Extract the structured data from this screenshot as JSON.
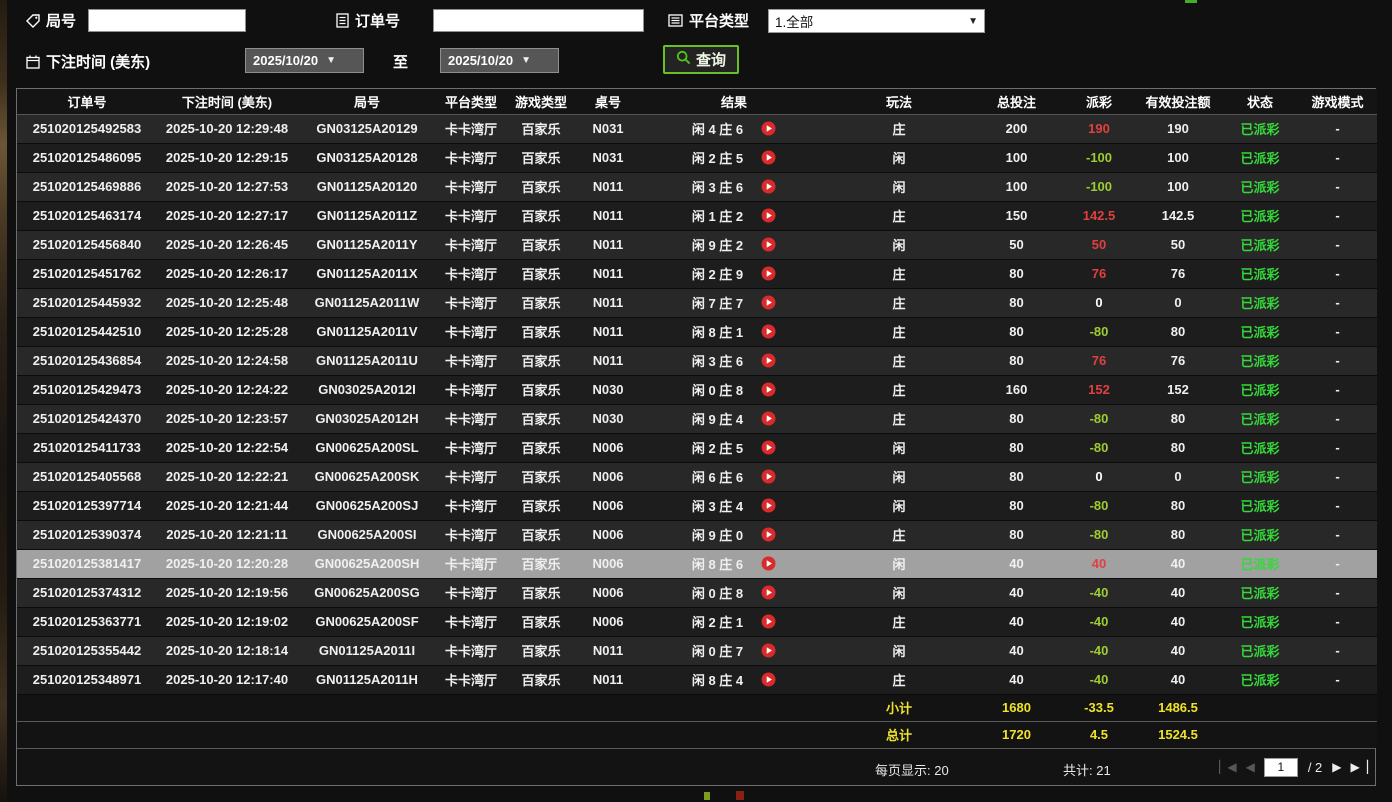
{
  "filters": {
    "round_label": "局号",
    "order_label": "订单号",
    "platform_label": "平台类型",
    "platform_value": "1.全部",
    "bet_time_label": "下注时间 (美东)",
    "to_label": "至",
    "date_from": "2025/10/20",
    "date_to": "2025/10/20",
    "query_label": "查询"
  },
  "table": {
    "columns": [
      "订单号",
      "下注时间 (美东)",
      "局号",
      "平台类型",
      "游戏类型",
      "桌号",
      "结果",
      "玩法",
      "总投注",
      "派彩",
      "有效投注额",
      "状态",
      "游戏模式"
    ],
    "rows": [
      {
        "order": "251020125492583",
        "time": "2025-10-20 12:29:48",
        "round": "GN03125A20129",
        "platform": "卡卡湾厅",
        "game": "百家乐",
        "table_no": "N031",
        "result": "闲 4 庄 6",
        "play": "庄",
        "total": "200",
        "payout": "190",
        "payout_type": "win",
        "valid": "190",
        "status": "已派彩",
        "mode": "-",
        "selected": false
      },
      {
        "order": "251020125486095",
        "time": "2025-10-20 12:29:15",
        "round": "GN03125A20128",
        "platform": "卡卡湾厅",
        "game": "百家乐",
        "table_no": "N031",
        "result": "闲 2 庄 5",
        "play": "闲",
        "total": "100",
        "payout": "-100",
        "payout_type": "loss",
        "valid": "100",
        "status": "已派彩",
        "mode": "-",
        "selected": false
      },
      {
        "order": "251020125469886",
        "time": "2025-10-20 12:27:53",
        "round": "GN01125A20120",
        "platform": "卡卡湾厅",
        "game": "百家乐",
        "table_no": "N011",
        "result": "闲 3 庄 6",
        "play": "闲",
        "total": "100",
        "payout": "-100",
        "payout_type": "loss",
        "valid": "100",
        "status": "已派彩",
        "mode": "-",
        "selected": false
      },
      {
        "order": "251020125463174",
        "time": "2025-10-20 12:27:17",
        "round": "GN01125A2011Z",
        "platform": "卡卡湾厅",
        "game": "百家乐",
        "table_no": "N011",
        "result": "闲 1 庄 2",
        "play": "庄",
        "total": "150",
        "payout": "142.5",
        "payout_type": "win",
        "valid": "142.5",
        "status": "已派彩",
        "mode": "-",
        "selected": false
      },
      {
        "order": "251020125456840",
        "time": "2025-10-20 12:26:45",
        "round": "GN01125A2011Y",
        "platform": "卡卡湾厅",
        "game": "百家乐",
        "table_no": "N011",
        "result": "闲 9 庄 2",
        "play": "闲",
        "total": "50",
        "payout": "50",
        "payout_type": "win",
        "valid": "50",
        "status": "已派彩",
        "mode": "-",
        "selected": false
      },
      {
        "order": "251020125451762",
        "time": "2025-10-20 12:26:17",
        "round": "GN01125A2011X",
        "platform": "卡卡湾厅",
        "game": "百家乐",
        "table_no": "N011",
        "result": "闲 2 庄 9",
        "play": "庄",
        "total": "80",
        "payout": "76",
        "payout_type": "win",
        "valid": "76",
        "status": "已派彩",
        "mode": "-",
        "selected": false
      },
      {
        "order": "251020125445932",
        "time": "2025-10-20 12:25:48",
        "round": "GN01125A2011W",
        "platform": "卡卡湾厅",
        "game": "百家乐",
        "table_no": "N011",
        "result": "闲 7 庄 7",
        "play": "庄",
        "total": "80",
        "payout": "0",
        "payout_type": "zero",
        "valid": "0",
        "status": "已派彩",
        "mode": "-",
        "selected": false
      },
      {
        "order": "251020125442510",
        "time": "2025-10-20 12:25:28",
        "round": "GN01125A2011V",
        "platform": "卡卡湾厅",
        "game": "百家乐",
        "table_no": "N011",
        "result": "闲 8 庄 1",
        "play": "庄",
        "total": "80",
        "payout": "-80",
        "payout_type": "loss",
        "valid": "80",
        "status": "已派彩",
        "mode": "-",
        "selected": false
      },
      {
        "order": "251020125436854",
        "time": "2025-10-20 12:24:58",
        "round": "GN01125A2011U",
        "platform": "卡卡湾厅",
        "game": "百家乐",
        "table_no": "N011",
        "result": "闲 3 庄 6",
        "play": "庄",
        "total": "80",
        "payout": "76",
        "payout_type": "win",
        "valid": "76",
        "status": "已派彩",
        "mode": "-",
        "selected": false
      },
      {
        "order": "251020125429473",
        "time": "2025-10-20 12:24:22",
        "round": "GN03025A2012I",
        "platform": "卡卡湾厅",
        "game": "百家乐",
        "table_no": "N030",
        "result": "闲 0 庄 8",
        "play": "庄",
        "total": "160",
        "payout": "152",
        "payout_type": "win",
        "valid": "152",
        "status": "已派彩",
        "mode": "-",
        "selected": false
      },
      {
        "order": "251020125424370",
        "time": "2025-10-20 12:23:57",
        "round": "GN03025A2012H",
        "platform": "卡卡湾厅",
        "game": "百家乐",
        "table_no": "N030",
        "result": "闲 9 庄 4",
        "play": "庄",
        "total": "80",
        "payout": "-80",
        "payout_type": "loss",
        "valid": "80",
        "status": "已派彩",
        "mode": "-",
        "selected": false
      },
      {
        "order": "251020125411733",
        "time": "2025-10-20 12:22:54",
        "round": "GN00625A200SL",
        "platform": "卡卡湾厅",
        "game": "百家乐",
        "table_no": "N006",
        "result": "闲 2 庄 5",
        "play": "闲",
        "total": "80",
        "payout": "-80",
        "payout_type": "loss",
        "valid": "80",
        "status": "已派彩",
        "mode": "-",
        "selected": false
      },
      {
        "order": "251020125405568",
        "time": "2025-10-20 12:22:21",
        "round": "GN00625A200SK",
        "platform": "卡卡湾厅",
        "game": "百家乐",
        "table_no": "N006",
        "result": "闲 6 庄 6",
        "play": "闲",
        "total": "80",
        "payout": "0",
        "payout_type": "zero",
        "valid": "0",
        "status": "已派彩",
        "mode": "-",
        "selected": false
      },
      {
        "order": "251020125397714",
        "time": "2025-10-20 12:21:44",
        "round": "GN00625A200SJ",
        "platform": "卡卡湾厅",
        "game": "百家乐",
        "table_no": "N006",
        "result": "闲 3 庄 4",
        "play": "闲",
        "total": "80",
        "payout": "-80",
        "payout_type": "loss",
        "valid": "80",
        "status": "已派彩",
        "mode": "-",
        "selected": false
      },
      {
        "order": "251020125390374",
        "time": "2025-10-20 12:21:11",
        "round": "GN00625A200SI",
        "platform": "卡卡湾厅",
        "game": "百家乐",
        "table_no": "N006",
        "result": "闲 9 庄 0",
        "play": "庄",
        "total": "80",
        "payout": "-80",
        "payout_type": "loss",
        "valid": "80",
        "status": "已派彩",
        "mode": "-",
        "selected": false
      },
      {
        "order": "251020125381417",
        "time": "2025-10-20 12:20:28",
        "round": "GN00625A200SH",
        "platform": "卡卡湾厅",
        "game": "百家乐",
        "table_no": "N006",
        "result": "闲 8 庄 6",
        "play": "闲",
        "total": "40",
        "payout": "40",
        "payout_type": "win",
        "valid": "40",
        "status": "已派彩",
        "mode": "-",
        "selected": true
      },
      {
        "order": "251020125374312",
        "time": "2025-10-20 12:19:56",
        "round": "GN00625A200SG",
        "platform": "卡卡湾厅",
        "game": "百家乐",
        "table_no": "N006",
        "result": "闲 0 庄 8",
        "play": "闲",
        "total": "40",
        "payout": "-40",
        "payout_type": "loss",
        "valid": "40",
        "status": "已派彩",
        "mode": "-",
        "selected": false
      },
      {
        "order": "251020125363771",
        "time": "2025-10-20 12:19:02",
        "round": "GN00625A200SF",
        "platform": "卡卡湾厅",
        "game": "百家乐",
        "table_no": "N006",
        "result": "闲 2 庄 1",
        "play": "庄",
        "total": "40",
        "payout": "-40",
        "payout_type": "loss",
        "valid": "40",
        "status": "已派彩",
        "mode": "-",
        "selected": false
      },
      {
        "order": "251020125355442",
        "time": "2025-10-20 12:18:14",
        "round": "GN01125A2011I",
        "platform": "卡卡湾厅",
        "game": "百家乐",
        "table_no": "N011",
        "result": "闲 0 庄 7",
        "play": "闲",
        "total": "40",
        "payout": "-40",
        "payout_type": "loss",
        "valid": "40",
        "status": "已派彩",
        "mode": "-",
        "selected": false
      },
      {
        "order": "251020125348971",
        "time": "2025-10-20 12:17:40",
        "round": "GN01125A2011H",
        "platform": "卡卡湾厅",
        "game": "百家乐",
        "table_no": "N011",
        "result": "闲 8 庄 4",
        "play": "庄",
        "total": "40",
        "payout": "-40",
        "payout_type": "loss",
        "valid": "40",
        "status": "已派彩",
        "mode": "-",
        "selected": false
      }
    ],
    "subtotal": {
      "label": "小计",
      "total": "1680",
      "payout": "-33.5",
      "valid": "1486.5"
    },
    "grand_total": {
      "label": "总计",
      "total": "1720",
      "payout": "4.5",
      "valid": "1524.5"
    }
  },
  "footer": {
    "per_page": "每页显示: 20",
    "total_count": "共计: 21",
    "page": "1",
    "page_suffix": "/ 2",
    "pager": {
      "first": "▏◀",
      "prev": "◀",
      "next": "▶",
      "last": "▶▕"
    }
  },
  "colors": {
    "payout_win": "#e14040",
    "payout_loss": "#9dcd32",
    "payout_zero": "#ffffff",
    "status_paid": "#35d83a",
    "summary": "#efe32a",
    "query_border": "#69bf27",
    "selected_row": "#a1a1a1"
  }
}
